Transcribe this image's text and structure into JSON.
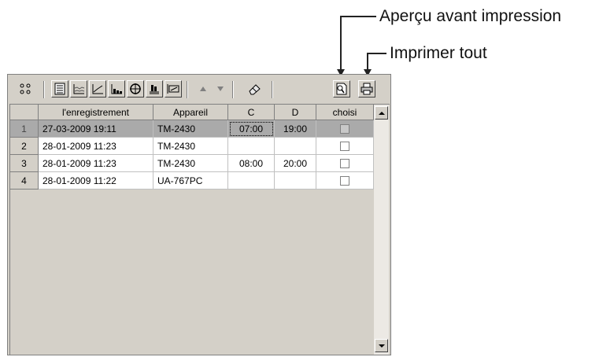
{
  "callouts": {
    "preview": "Aperçu avant impression",
    "print_all": "Imprimer tout"
  },
  "toolbar": {
    "buttons": [
      {
        "icon": "grid-dots-icon"
      },
      {
        "icon": "list-view-icon"
      },
      {
        "icon": "trend-chart-icon"
      },
      {
        "icon": "line-chart-icon"
      },
      {
        "icon": "bar-chart-icon"
      },
      {
        "icon": "target-icon"
      },
      {
        "icon": "histogram-icon"
      },
      {
        "icon": "average-icon"
      },
      {
        "icon": "sort-up-icon"
      },
      {
        "icon": "sort-down-icon"
      },
      {
        "icon": "eraser-icon"
      },
      {
        "icon": "print-preview-icon"
      },
      {
        "icon": "print-all-icon"
      }
    ]
  },
  "table": {
    "headers": [
      "l'enregistrement",
      "Appareil",
      "C",
      "D",
      "choisi"
    ],
    "rows": [
      {
        "num": "1",
        "date": "27-03-2009 19:11",
        "device": "TM-2430",
        "c": "07:00",
        "d": "19:00",
        "checked": false,
        "selected": true
      },
      {
        "num": "2",
        "date": "28-01-2009 11:23",
        "device": "TM-2430",
        "c": "",
        "d": "",
        "checked": false,
        "selected": false
      },
      {
        "num": "3",
        "date": "28-01-2009 11:23",
        "device": "TM-2430",
        "c": "08:00",
        "d": "20:00",
        "checked": false,
        "selected": false
      },
      {
        "num": "4",
        "date": "28-01-2009 11:22",
        "device": "UA-767PC",
        "c": "",
        "d": "",
        "checked": false,
        "selected": false
      }
    ]
  },
  "colors": {
    "selected_row": "#aaaaaa",
    "chrome": "#d4d0c8"
  }
}
